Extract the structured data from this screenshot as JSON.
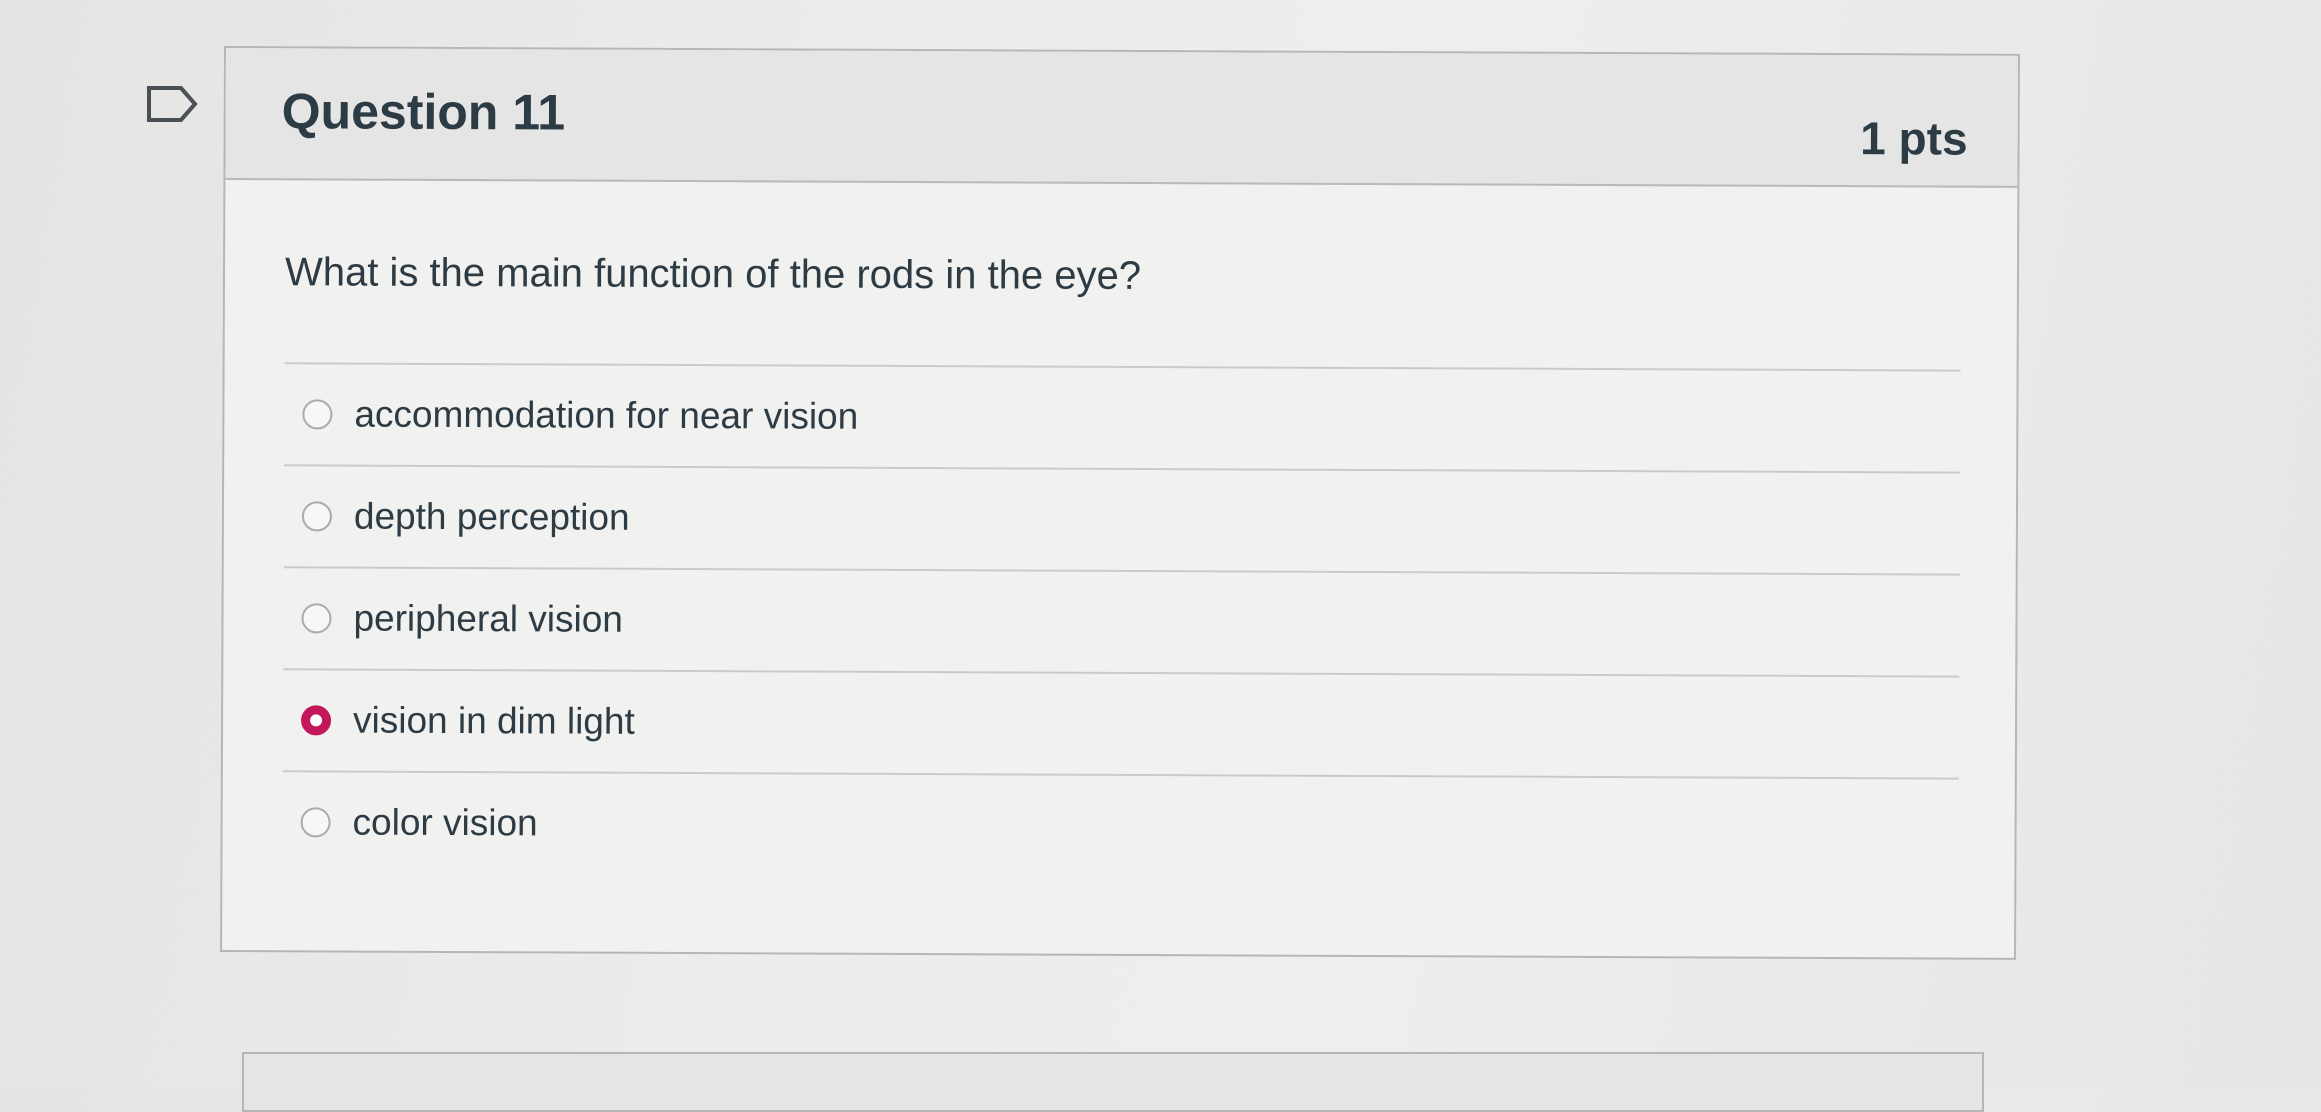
{
  "question": {
    "title": "Question 11",
    "points": "1 pts",
    "text": "What is the main function of the rods in the eye?",
    "answers": [
      {
        "label": "accommodation for near vision",
        "selected": false
      },
      {
        "label": "depth perception",
        "selected": false
      },
      {
        "label": "peripheral vision",
        "selected": false
      },
      {
        "label": "vision in dim light",
        "selected": true
      },
      {
        "label": "color vision",
        "selected": false
      }
    ]
  },
  "icons": {
    "flag": "flag-question-icon"
  },
  "colors": {
    "accent": "#c2185b",
    "text": "#2d3b45",
    "header_bg": "#e4e5e4",
    "border": "#b5b7b6"
  }
}
